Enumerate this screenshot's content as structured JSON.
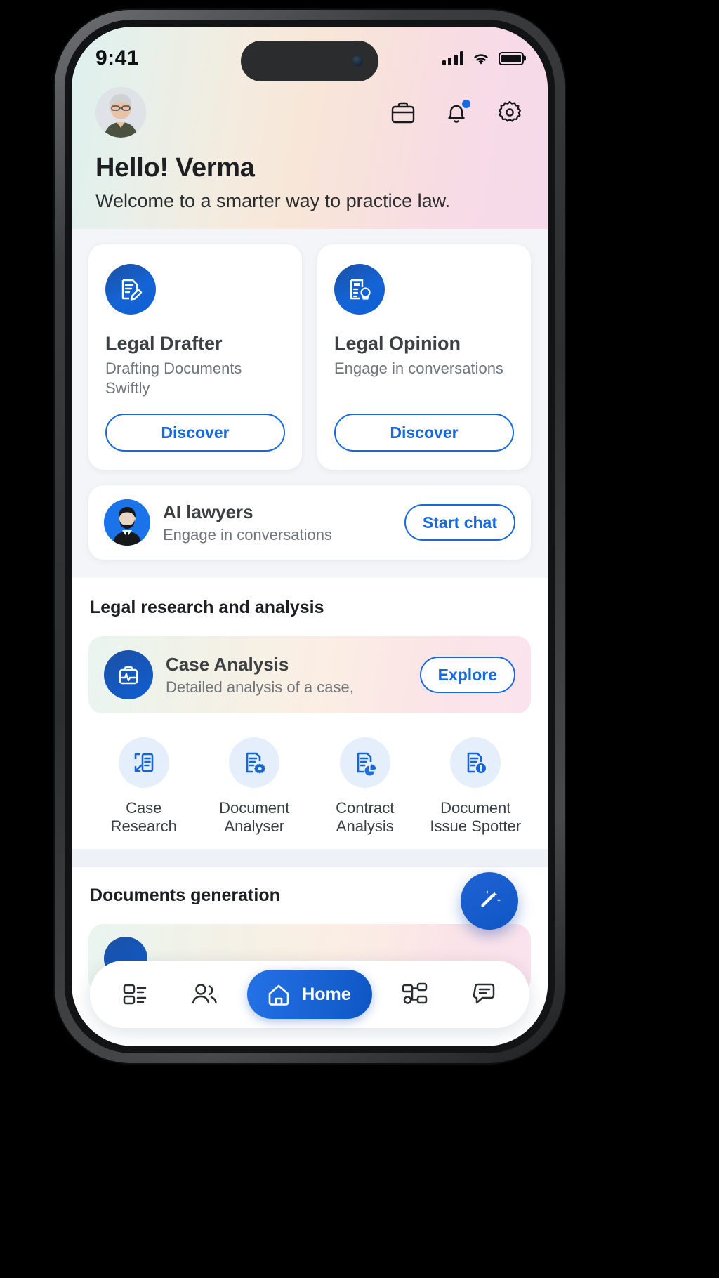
{
  "status_bar": {
    "time": "9:41",
    "signal_icon": "cellular-bars-icon",
    "wifi_icon": "wifi-icon",
    "battery_icon": "battery-full-icon"
  },
  "header": {
    "avatar_name": "user-avatar",
    "icons": [
      {
        "name": "briefcase-icon",
        "label": "Briefcase"
      },
      {
        "name": "bell-icon",
        "label": "Notifications",
        "has_badge": true
      },
      {
        "name": "gear-icon",
        "label": "Settings"
      }
    ],
    "greeting": "Hello! Verma",
    "subtitle": "Welcome to a smarter way to practice law."
  },
  "feature_cards": [
    {
      "icon": "document-edit-icon",
      "title": "Legal Drafter",
      "subtitle": "Drafting Documents Swiftly",
      "button": "Discover"
    },
    {
      "icon": "document-lightbulb-icon",
      "title": "Legal Opinion",
      "subtitle": "Engage in conversations",
      "button": "Discover"
    }
  ],
  "ai_lawyers": {
    "avatar": "lawyer-avatar-icon",
    "title": "AI lawyers",
    "subtitle": "Engage in conversations",
    "button": "Start chat"
  },
  "research_section": {
    "heading": "Legal research and analysis",
    "featured": {
      "icon": "briefcase-pulse-icon",
      "title": "Case Analysis",
      "subtitle": "Detailed analysis of a case,",
      "button": "Explore"
    },
    "quick_actions": [
      {
        "icon": "case-research-icon",
        "line1": "Case",
        "line2": "Research"
      },
      {
        "icon": "document-gear-icon",
        "line1": "Document",
        "line2": "Analyser"
      },
      {
        "icon": "document-chart-icon",
        "line1": "Contract",
        "line2": "Analysis"
      },
      {
        "icon": "document-alert-icon",
        "line1": "Document",
        "line2": "Issue Spotter"
      }
    ]
  },
  "documents_section": {
    "heading": "Documents generation"
  },
  "fab": {
    "icon": "magic-wand-sparkles-icon",
    "label": "AI assistant"
  },
  "bottom_nav": {
    "items": [
      {
        "name": "dashboard",
        "icon": "dashboard-icon",
        "label": "",
        "active": false
      },
      {
        "name": "community",
        "icon": "people-icon",
        "label": "",
        "active": false
      },
      {
        "name": "home",
        "icon": "home-icon",
        "label": "Home",
        "active": true
      },
      {
        "name": "workflow",
        "icon": "workflow-icon",
        "label": "",
        "active": false
      },
      {
        "name": "chat",
        "icon": "chat-bubble-icon",
        "label": "",
        "active": false
      }
    ]
  },
  "colors": {
    "primary_blue": "#1769e0",
    "deep_blue": "#0f56c4",
    "text_dark": "#1d1f22",
    "text_muted": "#70757a",
    "panel_grey": "#f3f5f8",
    "badge_blue": "#1769e0"
  }
}
